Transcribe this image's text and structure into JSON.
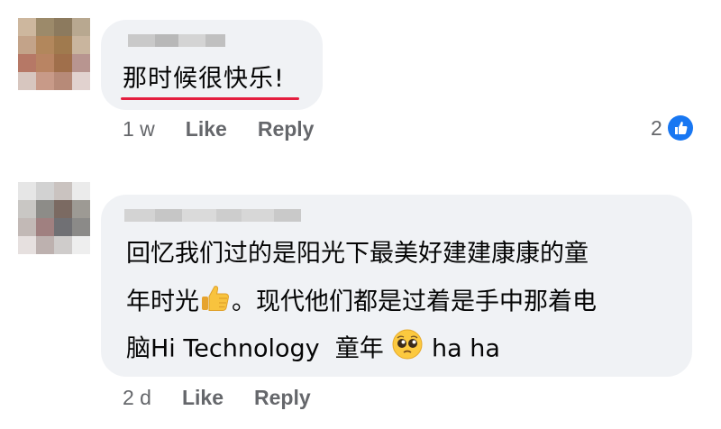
{
  "comments": [
    {
      "text": "那时候很快乐!",
      "time": "1 w",
      "like_label": "Like",
      "reply_label": "Reply",
      "reaction_count": "2"
    },
    {
      "line1": "回忆我们过的是阳光下最美好建建康康的童",
      "line2_a": "年时光",
      "line2_b": "。现代他们都是过着是手中那着电",
      "line3_a": "脑Hi Technology  童年",
      "line3_b": "ha ha",
      "time": "2 d",
      "like_label": "Like",
      "reply_label": "Reply"
    }
  ],
  "colors": {
    "bubble": "#f0f2f5",
    "meta": "#65676b",
    "like_blue": "#1877f2",
    "underline": "#e41e3f"
  },
  "icons": [
    "like-reaction-icon",
    "thumbs-up-emoji",
    "pleading-face-emoji"
  ]
}
